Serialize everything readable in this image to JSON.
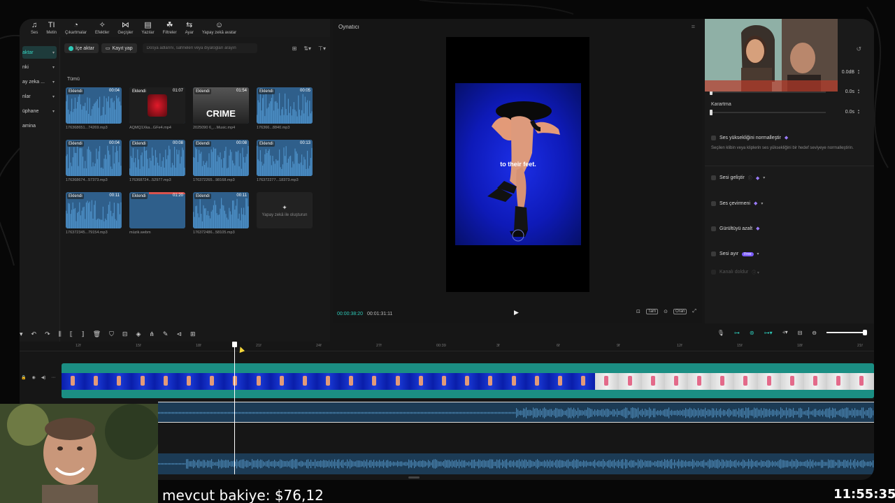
{
  "toolbar": {
    "items": [
      {
        "icon": "music-icon",
        "glyph": "♫",
        "label": "Ses"
      },
      {
        "icon": "text-icon",
        "glyph": "TI",
        "label": "Metin"
      },
      {
        "icon": "sticker-icon",
        "glyph": "◔",
        "label": "Çıkartmalar"
      },
      {
        "icon": "effects-icon",
        "glyph": "✧",
        "label": "Efektler"
      },
      {
        "icon": "transitions-icon",
        "glyph": "⋈",
        "label": "Geçişler"
      },
      {
        "icon": "captions-icon",
        "glyph": "▤",
        "label": "Yazılar"
      },
      {
        "icon": "filters-icon",
        "glyph": "☘",
        "label": "Filtreler"
      },
      {
        "icon": "adjust-icon",
        "glyph": "⇆",
        "label": "Ayar"
      },
      {
        "icon": "ai-avatar-icon",
        "glyph": "☺",
        "label": "Yapay zekâ avatar"
      }
    ]
  },
  "leftnav": {
    "items": [
      {
        "label": "aktar",
        "active": true
      },
      {
        "label": "nki",
        "active": false
      },
      {
        "label": "ay zeka ...",
        "active": false
      },
      {
        "label": "nlar",
        "active": false
      },
      {
        "label": "üphane",
        "active": false
      },
      {
        "label": "amina",
        "active": false
      }
    ]
  },
  "media": {
    "import_label": "İçe aktar",
    "record_label": "Kayıt yap",
    "search_placeholder": "Dosya adlarını, sahneleri veya diyalogları arayın",
    "filter_label": "Tümü",
    "ai_tile_label": "Yapay zekâ ile oluşturun",
    "items": [
      {
        "badge": "Eklendi",
        "duration": "00:04",
        "name": "176368651...74269.mp3",
        "kind": "audio"
      },
      {
        "badge": "Eklendi",
        "duration": "01:07",
        "name": "AQMQ1Xka...GFe4.mp4",
        "kind": "video-red"
      },
      {
        "badge": "Eklendi",
        "duration": "01:54",
        "name": "2025090 6_...Music.mp4",
        "kind": "crime",
        "title": "CRIME"
      },
      {
        "badge": "Eklendi",
        "duration": "00:05",
        "name": "176366...8840.mp3",
        "kind": "audio"
      },
      {
        "badge": "Eklendi",
        "duration": "00:04",
        "name": "176368674...57373.mp3",
        "kind": "audio"
      },
      {
        "badge": "Eklendi",
        "duration": "00:08",
        "name": "176368724...52977.mp3",
        "kind": "audio"
      },
      {
        "badge": "Eklendi",
        "duration": "00:08",
        "name": "176372265...98168.mp3",
        "kind": "audio"
      },
      {
        "badge": "Eklendi",
        "duration": "00:13",
        "name": "176372277...18373.mp3",
        "kind": "audio"
      },
      {
        "badge": "Eklendi",
        "duration": "00:11",
        "name": "176372345...79154.mp3",
        "kind": "audio"
      },
      {
        "badge": "Eklendi",
        "duration": "01:20",
        "name": "müzik.webm",
        "kind": "plain"
      },
      {
        "badge": "Eklendi",
        "duration": "00:11",
        "name": "176372486...58105.mp3",
        "kind": "audio"
      }
    ]
  },
  "player": {
    "title": "Oynatıcı",
    "caption": "to their feet.",
    "current_time": "00:00:38:20",
    "total_time": "00:01:31:11",
    "ratio_label": "Oran",
    "fit_label": "Tam"
  },
  "right_panel": {
    "volume_value": "0.0dB",
    "fadein_value": "0.0s",
    "fadeout_label": "Karartma",
    "fadeout_value": "0.0s",
    "normalize_label": "Ses yüksekliğini normalleştir",
    "normalize_desc": "Seçilen klibin veya kliplerin ses yüksekliğini bir hedef seviyeye normalleştirin.",
    "enhance_label": "Sesi geliştir",
    "voice_change_label": "Ses çevirmeni",
    "denoise_label": "Gürültüyü azalt",
    "separate_label": "Sesi ayır",
    "free_label": "Free",
    "fill_label": "Kanalı doldur"
  },
  "timeline": {
    "ticks": [
      "12f",
      "15f",
      "18f",
      "21f",
      "24f",
      "27f",
      "00:39",
      "3f",
      "6f",
      "9f",
      "12f",
      "15f",
      "18f",
      "21f"
    ]
  },
  "overlay": {
    "balance": "mevcut bakiye: $76,12",
    "clock": "11:55:35"
  },
  "colors": {
    "accent": "#2ec9b8",
    "video_track": "#1b8e83",
    "audio_track": "#1c3b55",
    "video_bg": "#1427d0"
  }
}
